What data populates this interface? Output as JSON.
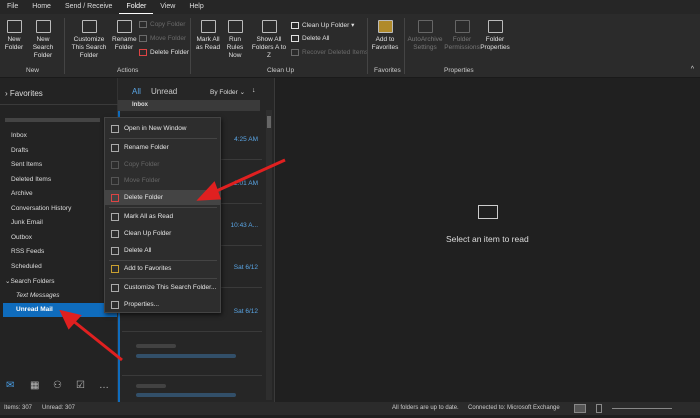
{
  "tabs": [
    "File",
    "Home",
    "Send / Receive",
    "Folder",
    "View",
    "Help"
  ],
  "ribbon": {
    "new_folder": "New Folder",
    "new_search_folder": "New Search Folder",
    "group_new": "New",
    "customize": "Customize This Search Folder",
    "rename": "Rename Folder",
    "copy": "Copy Folder",
    "move": "Move Folder",
    "delete": "Delete Folder",
    "group_actions": "Actions",
    "mark_all_read": "Mark All as Read",
    "run_rules": "Run Rules Now",
    "show_all": "Show All Folders A to Z",
    "clean_up": "Clean Up Folder ▾",
    "delete_all": "Delete All",
    "recover": "Recover Deleted Items",
    "group_cleanup": "Clean Up",
    "add_fav": "Add to Favorites",
    "group_fav": "Favorites",
    "autoarchive": "AutoArchive Settings",
    "permissions": "Folder Permissions",
    "properties": "Folder Properties",
    "group_props": "Properties"
  },
  "folders": {
    "favorites": "Favorites",
    "items": [
      "Inbox",
      "Drafts",
      "Sent Items",
      "Deleted Items",
      "Archive",
      "Conversation History",
      "Junk Email",
      "Outbox",
      "RSS Feeds",
      "Scheduled"
    ],
    "search_folders": "Search Folders",
    "text_messages": "Text Messages",
    "unread_mail": "Unread Mail"
  },
  "list": {
    "all": "All",
    "unread": "Unread",
    "by_folder": "By Folder ⌄",
    "sort": "↓",
    "inbox_header": "Inbox",
    "times": [
      "4:25 AM",
      "2:01 AM",
      "10:43 A...",
      "Sat 6/12",
      "Sat 6/12"
    ]
  },
  "menu": [
    "Open in New Window",
    "Rename Folder",
    "Copy Folder",
    "Move Folder",
    "Delete Folder",
    "Mark All as Read",
    "Clean Up Folder",
    "Delete All",
    "Add to Favorites",
    "Customize This Search Folder...",
    "Properties..."
  ],
  "reading": {
    "empty": "Select an item to read"
  },
  "status": {
    "items": "Items: 307",
    "unread": "Unread: 307",
    "sync": "All folders are up to date.",
    "connected": "Connected to: Microsoft Exchange"
  },
  "colors": {
    "accent": "#0f6cbd",
    "arrow": "#e02020"
  }
}
